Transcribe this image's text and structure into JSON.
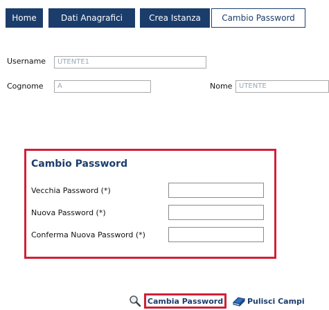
{
  "tabs": [
    {
      "label": "Home"
    },
    {
      "label": "Dati Anagrafici"
    },
    {
      "label": "Crea Istanza"
    },
    {
      "label": "Cambio Password"
    }
  ],
  "form": {
    "username_label": "Username",
    "username_value": "UTENTE1",
    "cognome_label": "Cognome",
    "cognome_value": "A",
    "nome_label": "Nome",
    "nome_value": "UTENTE"
  },
  "password_panel": {
    "title": "Cambio Password",
    "old_label": "Vecchia Password (*)",
    "new_label": "Nuova Password (*)",
    "confirm_label": "Conferma Nuova Password (*)"
  },
  "actions": {
    "change_label": "Cambia Password",
    "clear_label": "Pulisci Campi"
  },
  "colors": {
    "tab_bg": "#1b3d6b",
    "highlight": "#d11f37"
  },
  "icons": {
    "search": "magnifier-icon",
    "clear": "eraser-icon"
  }
}
